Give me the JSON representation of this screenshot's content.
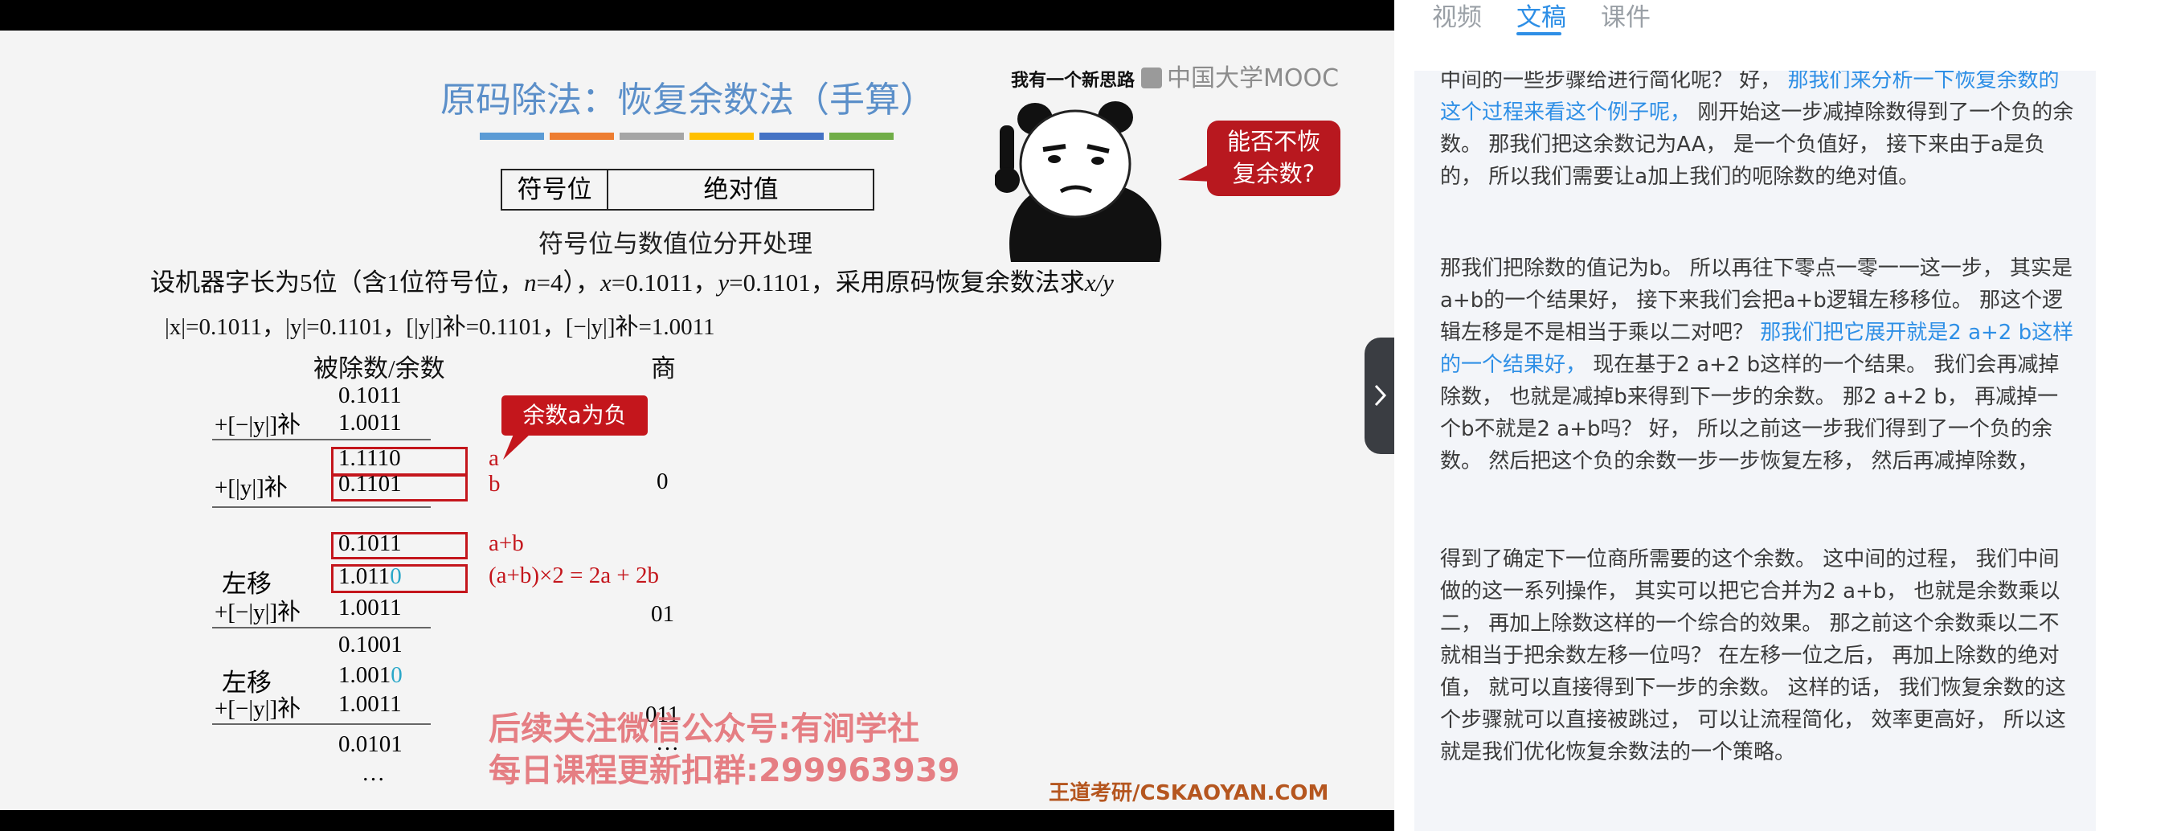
{
  "slide": {
    "title": "原码除法：恢复余数法（手算）",
    "underline_colors": [
      "#5b9bd5",
      "#ed7d31",
      "#a5a5a5",
      "#ffc000",
      "#4472c4",
      "#70ad47"
    ],
    "table_sign": "符号位",
    "table_abs": "绝对值",
    "subtitle": "符号位与数值位分开处理",
    "problem_prefix": "设机器字长为5位（含1位符号位，",
    "problem_n": "n",
    "problem_n_val": "=4），",
    "problem_x": "x",
    "problem_x_val": "=0.1011，",
    "problem_y": "y",
    "problem_y_val": "=0.1101，采用原码恢复余数法求",
    "problem_xy": "x/y",
    "given_line": "|x|=0.1011，|y|=0.1101，[|y|]补=0.1101，[−|y|]补=1.0011",
    "header_dividend": "被除数/余数",
    "header_quotient": "商",
    "meme_caption": "我有一个新思路",
    "mooc_logo": "中国大学MOOC",
    "bubble_text": "能否不恢\n复余数?",
    "callout_text": "余数a为负",
    "label_a": "a",
    "label_b": "b",
    "label_ab": "a+b",
    "label_formula": "(a+b)×2 = 2a + 2b",
    "rows": {
      "r1": "0.1011",
      "op1": "+[−|y|]补",
      "r2": "1.0011",
      "r3": "1.1110",
      "op2": "+[|y|]补",
      "r4": "0.1101",
      "r5": "0.1011",
      "shift1": "左移",
      "r6": "1.011",
      "r6_tail": "0",
      "op3": "+[−|y|]补",
      "r7": "1.0011",
      "r8": "0.1001",
      "shift2": "左移",
      "r9": "1.001",
      "r9_tail": "0",
      "op4": "+[−|y|]补",
      "r10": "1.0011",
      "r11": "0.0101",
      "ellipsis": "…"
    },
    "quotients": {
      "q1": "0",
      "q2": "01",
      "q3": "011",
      "q4": "…"
    },
    "watermark_line1": "后续关注微信公众号:有涧学社",
    "watermark_line2": "每日课程更新扣群:299963939",
    "footer_brand": "王道考研/CSKAOYAN.COM"
  },
  "panel": {
    "tabs": [
      {
        "label": "视频",
        "active": false
      },
      {
        "label": "文稿",
        "active": true
      },
      {
        "label": "课件",
        "active": false
      }
    ],
    "paragraphs": [
      [
        {
          "text": "中间的一些步骤给进行简化呢？ 好， ",
          "highlight": false
        },
        {
          "text": "那我们来分析一下恢复余数的这个过程来看这个例子呢，",
          "highlight": true
        },
        {
          "text": " 刚开始这一步减掉除数得到了一个负的余数。 那我们把这余数记为AA， 是一个负值好， 接下来由于a是负的， 所以我们需要让a加上我们的呃除数的绝对值。",
          "highlight": false
        }
      ],
      [
        {
          "text": "那我们把除数的值记为b。 所以再往下零点一零一一这一步， 其实是a+b的一个结果好， 接下来我们会把a+b逻辑左移移位。 那这个逻辑左移是不是相当于乘以二对吧？ ",
          "highlight": false
        },
        {
          "text": "那我们把它展开就是2 a+2 b这样的一个结果好，",
          "highlight": true
        },
        {
          "text": " 现在基于2 a+2 b这样的一个结果。 我们会再减掉除数， 也就是减掉b来得到下一步的余数。 那2 a+2 b， 再减掉一个b不就是2 a+b吗？ 好， 所以之前这一步我们得到了一个负的余数。 然后把这个负的余数一步一步恢复左移， 然后再减掉除数，",
          "highlight": false
        }
      ],
      [
        {
          "text": "得到了确定下一位商所需要的这个余数。 这中间的过程， 我们中间做的这一系列操作， 其实可以把它合并为2 a+b， 也就是余数乘以二， 再加上除数这样的一个综合的效果。 那之前这个余数乘以二不就相当于把余数左移一位吗？ 在左移一位之后， 再加上除数的绝对值， 就可以直接得到下一步的余数。 这样的话， 我们恢复余数的这个步骤就可以直接被跳过， 可以让流程简化， 效率更高好， 所以这就是我们优化恢复余数法的一个策略。",
          "highlight": false
        }
      ]
    ]
  }
}
